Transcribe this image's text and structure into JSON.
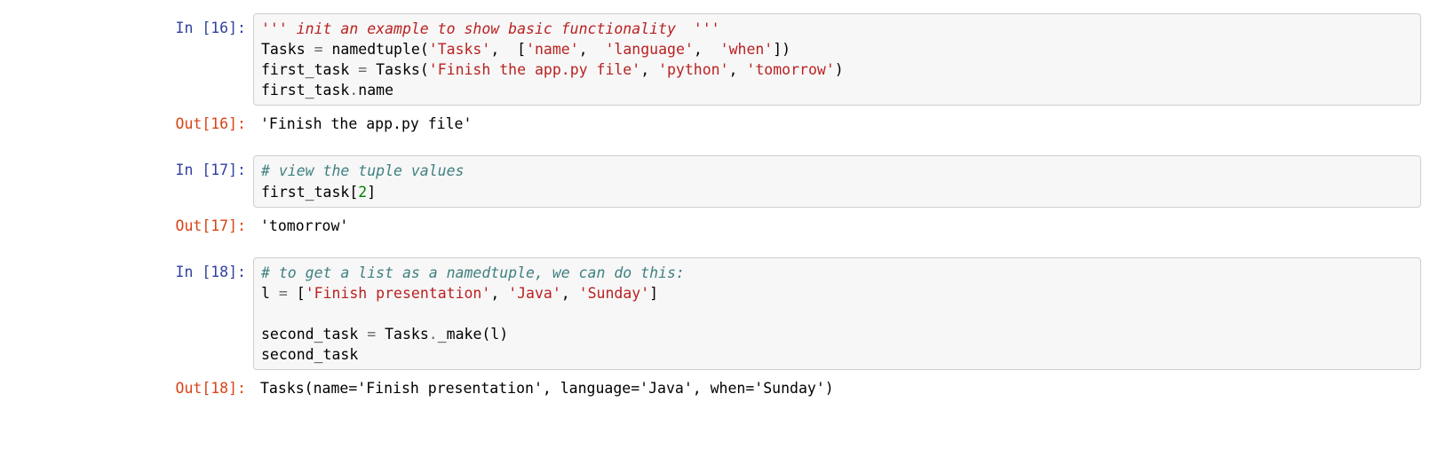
{
  "cells": [
    {
      "in_prompt": "In [16]:",
      "code_tokens": [
        [
          "doc",
          "''' init an example to show basic functionality  '''"
        ],
        [
          "nl",
          ""
        ],
        [
          "nm",
          "Tasks "
        ],
        [
          "op",
          "="
        ],
        [
          "nm",
          " namedtuple("
        ],
        [
          "str",
          "'Tasks'"
        ],
        [
          "nm",
          ",  ["
        ],
        [
          "str",
          "'name'"
        ],
        [
          "nm",
          ",  "
        ],
        [
          "str",
          "'language'"
        ],
        [
          "nm",
          ",  "
        ],
        [
          "str",
          "'when'"
        ],
        [
          "nm",
          "])"
        ],
        [
          "nl",
          ""
        ],
        [
          "nm",
          "first_task "
        ],
        [
          "op",
          "="
        ],
        [
          "nm",
          " Tasks("
        ],
        [
          "str",
          "'Finish the app.py file'"
        ],
        [
          "nm",
          ", "
        ],
        [
          "str",
          "'python'"
        ],
        [
          "nm",
          ", "
        ],
        [
          "str",
          "'tomorrow'"
        ],
        [
          "nm",
          ")"
        ],
        [
          "nl",
          ""
        ],
        [
          "nm",
          "first_task"
        ],
        [
          "op",
          "."
        ],
        [
          "nm",
          "name"
        ]
      ],
      "out_prompt": "Out[16]:",
      "output": "'Finish the app.py file'"
    },
    {
      "in_prompt": "In [17]:",
      "code_tokens": [
        [
          "cmt",
          "# view the tuple values"
        ],
        [
          "nl",
          ""
        ],
        [
          "nm",
          "first_task["
        ],
        [
          "num",
          "2"
        ],
        [
          "nm",
          "]"
        ]
      ],
      "out_prompt": "Out[17]:",
      "output": "'tomorrow'"
    },
    {
      "in_prompt": "In [18]:",
      "code_tokens": [
        [
          "cmt",
          "# to get a list as a namedtuple, we can do this:"
        ],
        [
          "nl",
          ""
        ],
        [
          "nm",
          "l "
        ],
        [
          "op",
          "="
        ],
        [
          "nm",
          " ["
        ],
        [
          "str",
          "'Finish presentation'"
        ],
        [
          "nm",
          ", "
        ],
        [
          "str",
          "'Java'"
        ],
        [
          "nm",
          ", "
        ],
        [
          "str",
          "'Sunday'"
        ],
        [
          "nm",
          "]"
        ],
        [
          "nl",
          ""
        ],
        [
          "nl",
          ""
        ],
        [
          "nm",
          "second_task "
        ],
        [
          "op",
          "="
        ],
        [
          "nm",
          " Tasks"
        ],
        [
          "op",
          "."
        ],
        [
          "nm",
          "_make(l)"
        ],
        [
          "nl",
          ""
        ],
        [
          "nm",
          "second_task"
        ]
      ],
      "out_prompt": "Out[18]:",
      "output": "Tasks(name='Finish presentation', language='Java', when='Sunday')"
    }
  ]
}
